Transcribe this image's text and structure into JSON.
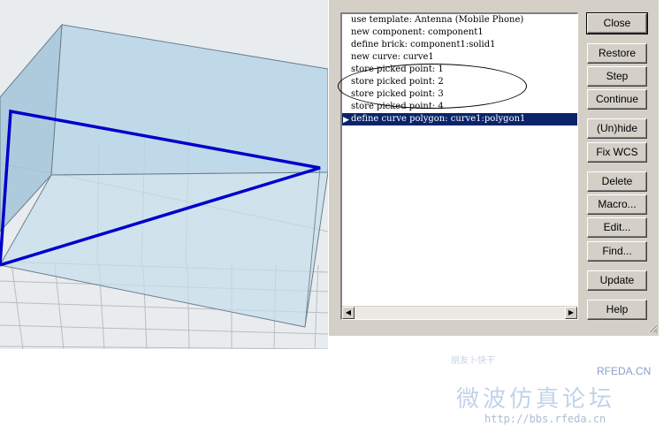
{
  "history": {
    "lines": [
      "use template: Antenna (Mobile Phone)",
      "new component: component1",
      "define brick: component1:solid1",
      "new curve: curve1",
      "store picked point: 1",
      "store picked point: 2",
      "store picked point: 3",
      "store picked point: 4",
      "define curve polygon: curve1:polygon1"
    ],
    "selected_index": 8
  },
  "buttons": {
    "close": "Close",
    "restore": "Restore",
    "step": "Step",
    "continue": "Continue",
    "unhide": "(Un)hide",
    "fix_wcs": "Fix WCS",
    "delete": "Delete",
    "macro": "Macro...",
    "edit": "Edit...",
    "find": "Find...",
    "update": "Update",
    "help": "Help"
  },
  "scrollbar": {
    "left_arrow": "◀",
    "right_arrow": "▶"
  },
  "watermark": {
    "top_text": "朋友卜快干",
    "brand": "RFEDA.CN",
    "title": "微波仿真论坛",
    "url": "http://bbs.rfeda.cn"
  },
  "colors": {
    "curve": "#0000cc",
    "brick_fill": "#a9cde0",
    "selection": "#0a246a",
    "dialog_face": "#d4d0c8"
  }
}
